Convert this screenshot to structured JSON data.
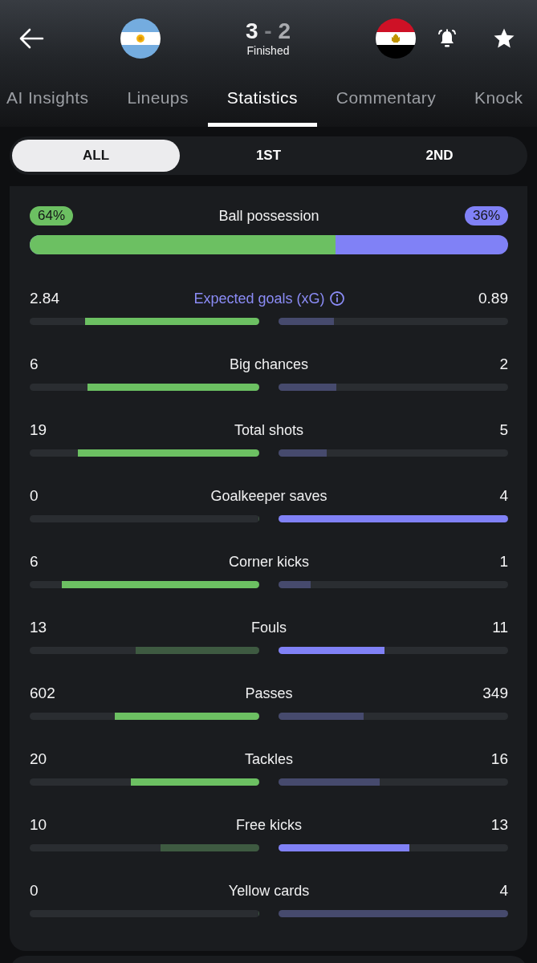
{
  "match": {
    "score": {
      "home": "3",
      "separator": "-",
      "away": "2"
    },
    "status": "Finished"
  },
  "tabs": [
    {
      "label": "AI Insights",
      "selected": false
    },
    {
      "label": "Lineups",
      "selected": false
    },
    {
      "label": "Statistics",
      "selected": true
    },
    {
      "label": "Commentary",
      "selected": false
    },
    {
      "label": "Knock",
      "selected": false
    }
  ],
  "periods": [
    {
      "label": "ALL",
      "selected": true
    },
    {
      "label": "1ST",
      "selected": false
    },
    {
      "label": "2ND",
      "selected": false
    }
  ],
  "possession": {
    "label": "Ball possession",
    "home": "64%",
    "away": "36%",
    "level": 0.64
  },
  "stats": [
    {
      "kind": "info",
      "label": "Expected goals (xG)",
      "home": {
        "value": "2.84",
        "level": 0.76,
        "highlighted": true
      },
      "away": {
        "value": "0.89",
        "level": 0.24,
        "highlighted": false
      }
    },
    {
      "kind": "plain",
      "label": "Big chances",
      "home": {
        "value": "6",
        "level": 0.75,
        "highlighted": true
      },
      "away": {
        "value": "2",
        "level": 0.25,
        "highlighted": false
      }
    },
    {
      "kind": "plain",
      "label": "Total shots",
      "home": {
        "value": "19",
        "level": 0.79,
        "highlighted": true
      },
      "away": {
        "value": "5",
        "level": 0.21,
        "highlighted": false
      }
    },
    {
      "kind": "plain",
      "label": "Goalkeeper saves",
      "home": {
        "value": "0",
        "level": 0
      },
      "away": {
        "value": "4",
        "level": 1,
        "highlighted": true
      }
    },
    {
      "kind": "plain",
      "label": "Corner kicks",
      "home": {
        "value": "6",
        "level": 0.86,
        "highlighted": true
      },
      "away": {
        "value": "1",
        "level": 0.14,
        "highlighted": false
      }
    },
    {
      "kind": "plain",
      "label": "Fouls",
      "home": {
        "value": "13",
        "level": 0.54,
        "highlighted": false
      },
      "away": {
        "value": "11",
        "level": 0.46,
        "highlighted": true
      }
    },
    {
      "kind": "plain",
      "label": "Passes",
      "home": {
        "value": "602",
        "level": 0.63,
        "highlighted": true
      },
      "away": {
        "value": "349",
        "level": 0.37,
        "highlighted": false
      }
    },
    {
      "kind": "plain",
      "label": "Tackles",
      "home": {
        "value": "20",
        "level": 0.56,
        "highlighted": true
      },
      "away": {
        "value": "16",
        "level": 0.44,
        "highlighted": false
      }
    },
    {
      "kind": "plain",
      "label": "Free kicks",
      "home": {
        "value": "10",
        "level": 0.43,
        "highlighted": false
      },
      "away": {
        "value": "13",
        "level": 0.57,
        "highlighted": true
      }
    },
    {
      "kind": "plain",
      "label": "Yellow cards",
      "home": {
        "value": "0",
        "level": 0
      },
      "away": {
        "value": "4",
        "level": 1,
        "highlighted": false
      }
    }
  ]
}
